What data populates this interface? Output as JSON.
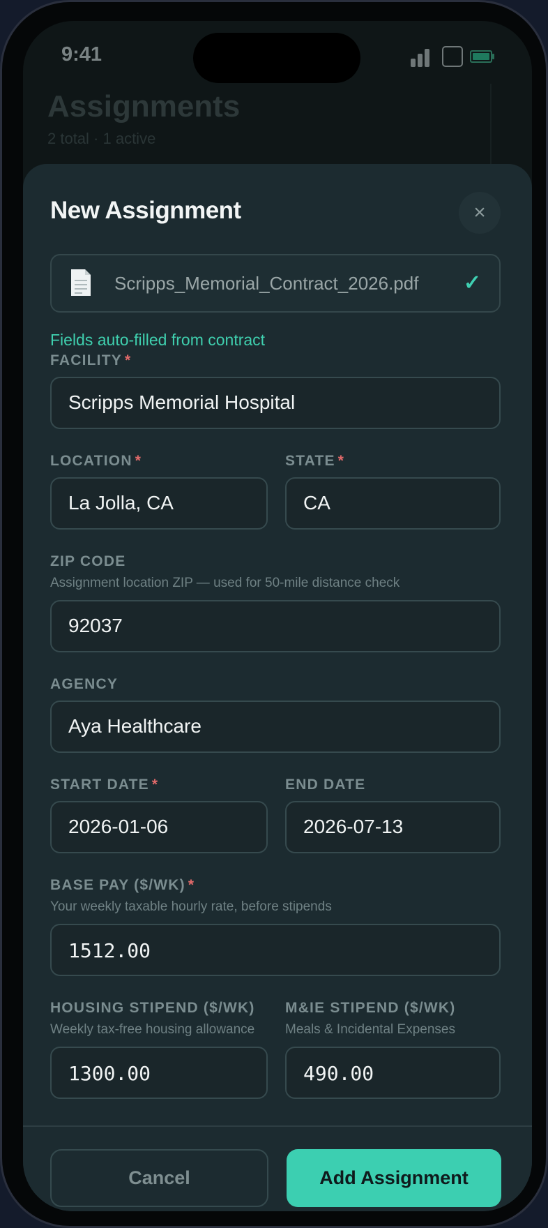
{
  "status": {
    "time": "9:41"
  },
  "background": {
    "title": "Assignments",
    "subtitle": "2 total · 1 active"
  },
  "sheet": {
    "title": "New Assignment",
    "close_glyph": "×",
    "file": {
      "name": "Scripps_Memorial_Contract_2026.pdf",
      "check": "✓",
      "icon": "document-icon"
    },
    "autofill_note": "Fields auto-filled from contract",
    "required_marker": "*",
    "fields": {
      "facility": {
        "label": "FACILITY",
        "value": "Scripps Memorial Hospital"
      },
      "location": {
        "label": "LOCATION",
        "value": "La Jolla, CA"
      },
      "state": {
        "label": "STATE",
        "value": "CA"
      },
      "zip": {
        "label": "ZIP CODE",
        "hint": "Assignment location ZIP — used for 50-mile distance check",
        "value": "92037"
      },
      "agency": {
        "label": "AGENCY",
        "value": "Aya Healthcare"
      },
      "start_date": {
        "label": "START DATE",
        "value": "2026-01-06"
      },
      "end_date": {
        "label": "END DATE",
        "value": "2026-07-13"
      },
      "base_pay": {
        "label": "BASE PAY ($/WK)",
        "hint": "Your weekly taxable hourly rate, before stipends",
        "value": "1512.00"
      },
      "housing": {
        "label": "HOUSING STIPEND ($/WK)",
        "hint": "Weekly tax-free housing allowance",
        "value": "1300.00"
      },
      "mie": {
        "label": "M&IE STIPEND ($/WK)",
        "hint": "Meals & Incidental Expenses",
        "value": "490.00"
      }
    },
    "buttons": {
      "cancel": "Cancel",
      "add": "Add Assignment"
    }
  },
  "colors": {
    "accent": "#3ccfb1",
    "required": "#e26a6a",
    "sheet_bg": "#1c2b30"
  }
}
